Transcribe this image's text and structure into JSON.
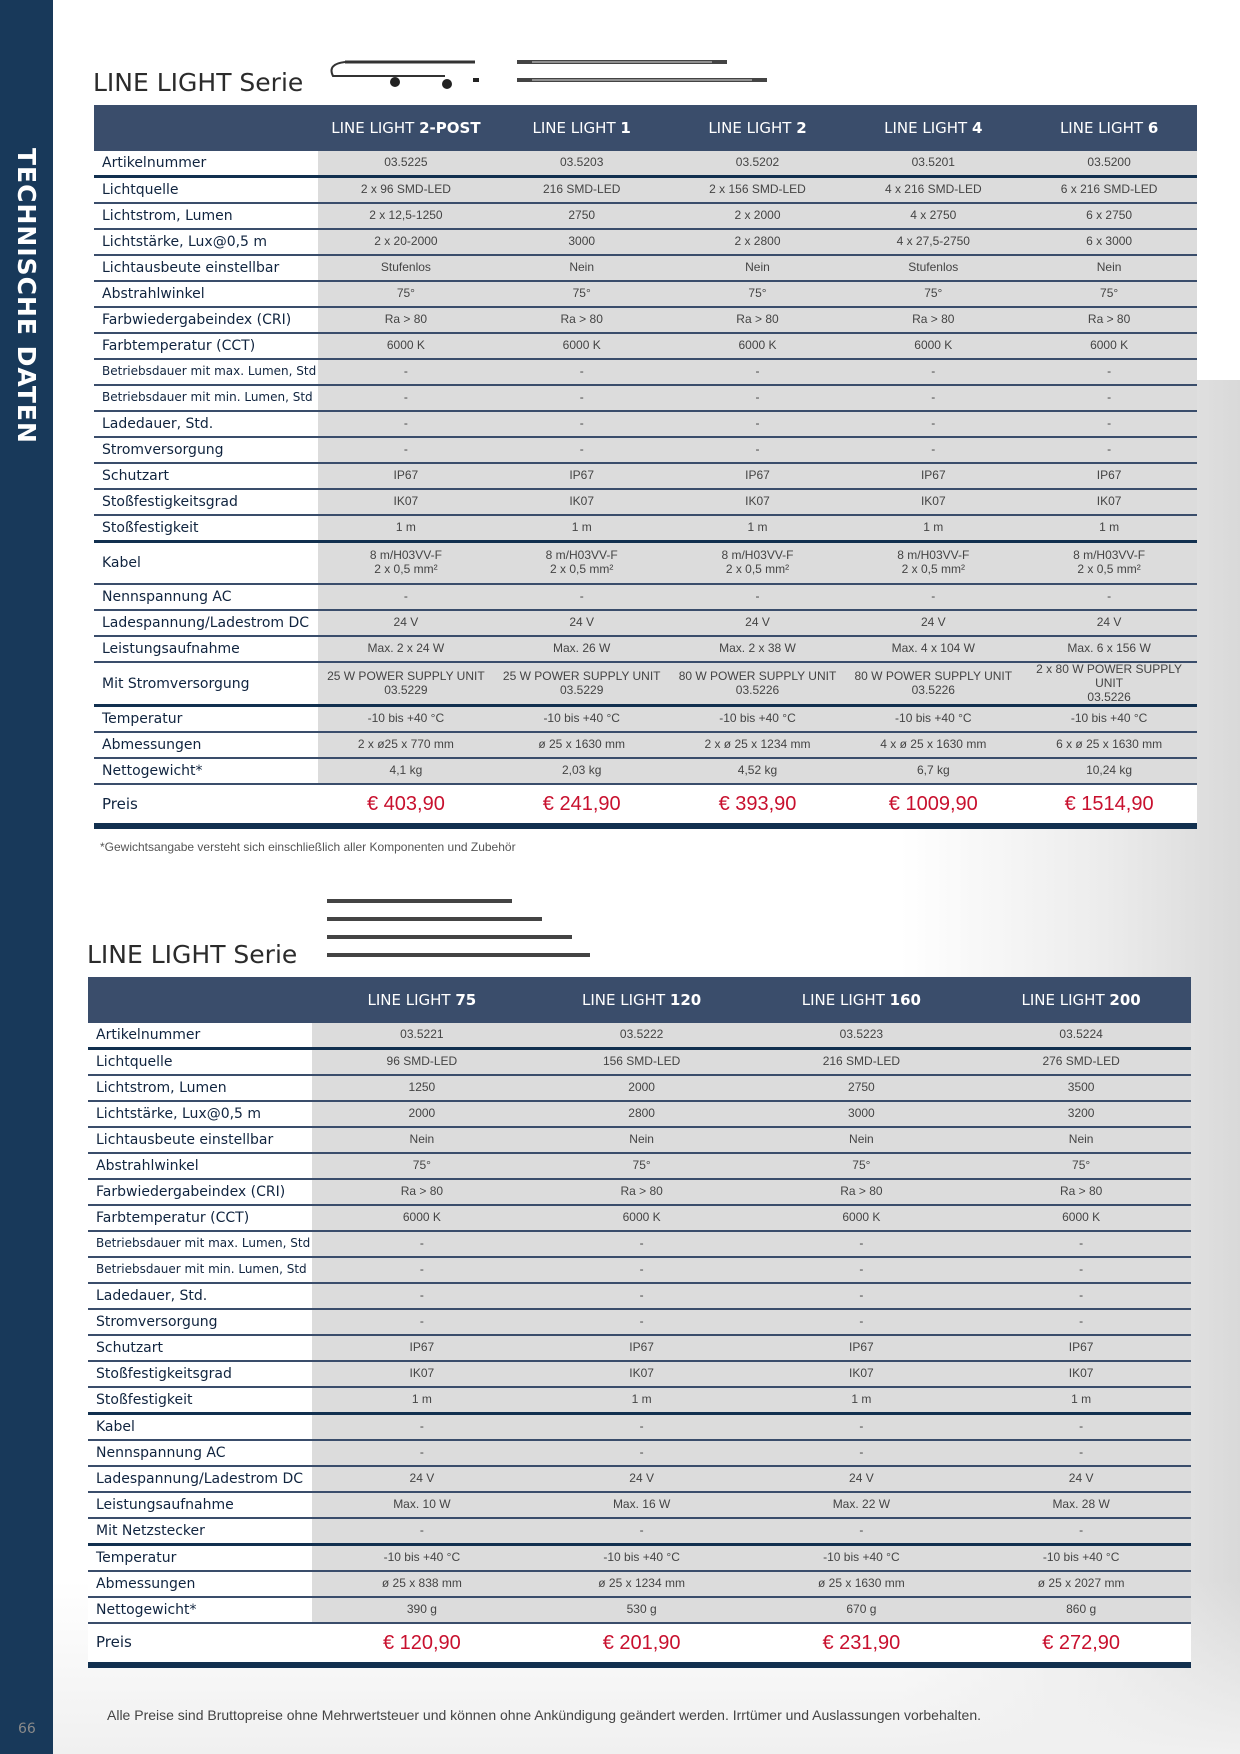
{
  "sidebar": {
    "title": "TECHNISCHE DATEN"
  },
  "page_number": "66",
  "section1": {
    "title": "LINE LIGHT Serie",
    "columns": [
      {
        "prefix": "LINE LIGHT ",
        "bold": "2-POST"
      },
      {
        "prefix": "LINE LIGHT ",
        "bold": "1"
      },
      {
        "prefix": "LINE LIGHT ",
        "bold": "2"
      },
      {
        "prefix": "LINE LIGHT ",
        "bold": "4"
      },
      {
        "prefix": "LINE LIGHT ",
        "bold": "6"
      }
    ],
    "rows": [
      {
        "label": "Artikelnummer",
        "values": [
          "03.5225",
          "03.5203",
          "03.5202",
          "03.5201",
          "03.5200"
        ],
        "thick": true
      },
      {
        "label": "Lichtquelle",
        "values": [
          "2 x 96 SMD-LED",
          "216 SMD-LED",
          "2 x 156 SMD-LED",
          "4 x 216 SMD-LED",
          "6 x 216 SMD-LED"
        ]
      },
      {
        "label": "Lichtstrom, Lumen",
        "values": [
          "2 x 12,5-1250",
          "2750",
          "2 x 2000",
          "4 x 2750",
          "6 x 2750"
        ]
      },
      {
        "label": "Lichtstärke, Lux@0,5 m",
        "values": [
          "2 x 20-2000",
          "3000",
          "2 x 2800",
          "4 x 27,5-2750",
          "6 x 3000"
        ]
      },
      {
        "label": "Lichtausbeute einstellbar",
        "values": [
          "Stufenlos",
          "Nein",
          "Nein",
          "Stufenlos",
          "Nein"
        ]
      },
      {
        "label": "Abstrahlwinkel",
        "values": [
          "75°",
          "75°",
          "75°",
          "75°",
          "75°"
        ]
      },
      {
        "label": "Farbwiedergabeindex (CRI)",
        "values": [
          "Ra > 80",
          "Ra > 80",
          "Ra > 80",
          "Ra > 80",
          "Ra > 80"
        ]
      },
      {
        "label": "Farbtemperatur (CCT)",
        "values": [
          "6000 K",
          "6000 K",
          "6000 K",
          "6000 K",
          "6000 K"
        ]
      },
      {
        "label": "Betriebsdauer mit max. Lumen, Std",
        "values": [
          "-",
          "-",
          "-",
          "-",
          "-"
        ],
        "small": true
      },
      {
        "label": "Betriebsdauer mit min. Lumen, Std",
        "values": [
          "-",
          "-",
          "-",
          "-",
          "-"
        ],
        "small": true
      },
      {
        "label": "Ladedauer, Std.",
        "values": [
          "-",
          "-",
          "-",
          "-",
          "-"
        ]
      },
      {
        "label": "Stromversorgung",
        "values": [
          "-",
          "-",
          "-",
          "-",
          "-"
        ]
      },
      {
        "label": "Schutzart",
        "values": [
          "IP67",
          "IP67",
          "IP67",
          "IP67",
          "IP67"
        ]
      },
      {
        "label": "Stoßfestigkeitsgrad",
        "values": [
          "IK07",
          "IK07",
          "IK07",
          "IK07",
          "IK07"
        ]
      },
      {
        "label": "Stoßfestigkeit",
        "values": [
          "1 m",
          "1 m",
          "1 m",
          "1 m",
          "1 m"
        ],
        "thick": true
      },
      {
        "label": "Kabel",
        "values": [
          "8 m/H03VV-F\n2 x 0,5 mm²",
          "8 m/H03VV-F\n2 x 0,5 mm²",
          "8 m/H03VV-F\n2 x 0,5 mm²",
          "8 m/H03VV-F\n2 x 0,5 mm²",
          "8 m/H03VV-F\n2 x 0,5 mm²"
        ],
        "tall": true
      },
      {
        "label": "Nennspannung AC",
        "values": [
          "-",
          "-",
          "-",
          "-",
          "-"
        ]
      },
      {
        "label": "Ladespannung/Ladestrom DC",
        "values": [
          "24 V",
          "24 V",
          "24 V",
          "24 V",
          "24 V"
        ]
      },
      {
        "label": "Leistungsaufnahme",
        "values": [
          "Max. 2 x 24 W",
          "Max. 26 W",
          "Max. 2 x 38 W",
          "Max. 4 x 104 W",
          "Max. 6 x 156 W"
        ]
      },
      {
        "label": "Mit Stromversorgung",
        "values": [
          "25 W POWER SUPPLY UNIT\n03.5229",
          "25 W POWER SUPPLY UNIT\n03.5229",
          "80 W POWER SUPPLY UNIT\n03.5226",
          "80 W POWER SUPPLY UNIT\n03.5226",
          "2 x 80 W POWER SUPPLY UNIT\n03.5226"
        ],
        "tall": true,
        "thick": true
      },
      {
        "label": "Temperatur",
        "values": [
          "-10 bis +40 °C",
          "-10 bis +40 °C",
          "-10 bis +40 °C",
          "-10 bis +40 °C",
          "-10 bis +40 °C"
        ]
      },
      {
        "label": "Abmessungen",
        "values": [
          "2 x ø25 x 770 mm",
          "ø 25 x 1630 mm",
          "2 x ø 25 x 1234 mm",
          "4 x ø 25 x 1630 mm",
          "6 x ø 25 x 1630 mm"
        ]
      },
      {
        "label": "Nettogewicht*",
        "values": [
          "4,1 kg",
          "2,03 kg",
          "4,52 kg",
          "6,7 kg",
          "10,24 kg"
        ]
      }
    ],
    "price": {
      "label": "Preis",
      "values": [
        "€ 403,90",
        "€ 241,90",
        "€ 393,90",
        "€ 1009,90",
        "€ 1514,90"
      ]
    },
    "footnote": "*Gewichtsangabe versteht sich einschließlich aller Komponenten und Zubehör"
  },
  "section2": {
    "title": "LINE LIGHT Serie",
    "columns": [
      {
        "prefix": "LINE LIGHT ",
        "bold": "75"
      },
      {
        "prefix": "LINE LIGHT ",
        "bold": "120"
      },
      {
        "prefix": "LINE LIGHT ",
        "bold": "160"
      },
      {
        "prefix": "LINE LIGHT ",
        "bold": "200"
      }
    ],
    "rows": [
      {
        "label": "Artikelnummer",
        "values": [
          "03.5221",
          "03.5222",
          "03.5223",
          "03.5224"
        ],
        "thick": true
      },
      {
        "label": "Lichtquelle",
        "values": [
          "96 SMD-LED",
          "156 SMD-LED",
          "216 SMD-LED",
          "276 SMD-LED"
        ]
      },
      {
        "label": "Lichtstrom, Lumen",
        "values": [
          "1250",
          "2000",
          "2750",
          "3500"
        ]
      },
      {
        "label": "Lichtstärke, Lux@0,5 m",
        "values": [
          "2000",
          "2800",
          "3000",
          "3200"
        ]
      },
      {
        "label": "Lichtausbeute einstellbar",
        "values": [
          "Nein",
          "Nein",
          "Nein",
          "Nein"
        ]
      },
      {
        "label": "Abstrahlwinkel",
        "values": [
          "75°",
          "75°",
          "75°",
          "75°"
        ]
      },
      {
        "label": "Farbwiedergabeindex (CRI)",
        "values": [
          "Ra > 80",
          "Ra > 80",
          "Ra > 80",
          "Ra > 80"
        ]
      },
      {
        "label": "Farbtemperatur (CCT)",
        "values": [
          "6000 K",
          "6000 K",
          "6000 K",
          "6000 K"
        ]
      },
      {
        "label": "Betriebsdauer mit max. Lumen, Std",
        "values": [
          "-",
          "-",
          "-",
          "-"
        ],
        "small": true
      },
      {
        "label": "Betriebsdauer mit min. Lumen, Std",
        "values": [
          "-",
          "-",
          "-",
          "-"
        ],
        "small": true
      },
      {
        "label": "Ladedauer, Std.",
        "values": [
          "-",
          "-",
          "-",
          "-"
        ]
      },
      {
        "label": "Stromversorgung",
        "values": [
          "-",
          "-",
          "-",
          "-"
        ]
      },
      {
        "label": "Schutzart",
        "values": [
          "IP67",
          "IP67",
          "IP67",
          "IP67"
        ]
      },
      {
        "label": "Stoßfestigkeitsgrad",
        "values": [
          "IK07",
          "IK07",
          "IK07",
          "IK07"
        ]
      },
      {
        "label": "Stoßfestigkeit",
        "values": [
          "1 m",
          "1 m",
          "1 m",
          "1 m"
        ],
        "thick": true
      },
      {
        "label": "Kabel",
        "values": [
          "-",
          "-",
          "-",
          "-"
        ]
      },
      {
        "label": "Nennspannung AC",
        "values": [
          "-",
          "-",
          "-",
          "-"
        ]
      },
      {
        "label": "Ladespannung/Ladestrom DC",
        "values": [
          "24 V",
          "24 V",
          "24 V",
          "24 V"
        ]
      },
      {
        "label": "Leistungsaufnahme",
        "values": [
          "Max. 10 W",
          "Max. 16 W",
          "Max. 22 W",
          "Max. 28 W"
        ]
      },
      {
        "label": "Mit Netzstecker",
        "values": [
          "-",
          "-",
          "-",
          "-"
        ],
        "thick": true
      },
      {
        "label": "Temperatur",
        "values": [
          "-10 bis +40 °C",
          "-10 bis +40 °C",
          "-10 bis +40 °C",
          "-10 bis +40 °C"
        ]
      },
      {
        "label": "Abmessungen",
        "values": [
          "ø 25 x 838 mm",
          "ø 25 x 1234 mm",
          "ø 25 x 1630 mm",
          "ø 25 x 2027 mm"
        ]
      },
      {
        "label": "Nettogewicht*",
        "values": [
          "390 g",
          "530 g",
          "670 g",
          "860 g"
        ]
      }
    ],
    "price": {
      "label": "Preis",
      "values": [
        "€ 120,90",
        "€ 201,90",
        "€ 231,90",
        "€ 272,90"
      ]
    }
  },
  "disclaimer": "Alle Preise sind Bruttopreise ohne Mehrwertsteuer und können ohne Ankündigung geändert werden. Irrtümer und Auslassungen vorbehalten.",
  "colors": {
    "sidebar": "#18395a",
    "header": "#3a4d6b",
    "price": "#c8102e",
    "cell": "#dcdcdc"
  }
}
